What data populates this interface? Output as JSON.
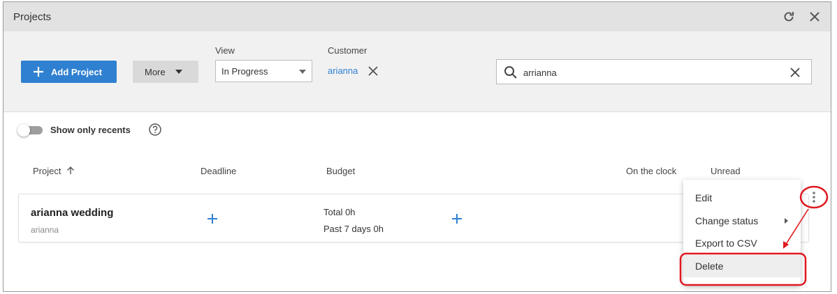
{
  "window": {
    "title": "Projects"
  },
  "toolbar": {
    "add_label": "Add Project",
    "more_label": "More",
    "view_label": "View",
    "view_value": "In Progress",
    "customer_label": "Customer",
    "customer_value": "arianna",
    "search_value": "arrianna"
  },
  "filters": {
    "recents_label": "Show only recents"
  },
  "table": {
    "columns": [
      "Project",
      "Deadline",
      "Budget",
      "On the clock",
      "Unread"
    ],
    "rows": [
      {
        "name": "arianna wedding",
        "customer": "arianna",
        "budget_total": "Total 0h",
        "budget_past": "Past 7 days 0h"
      }
    ]
  },
  "context_menu": {
    "items": [
      "Edit",
      "Change status",
      "Export to CSV",
      "Delete"
    ]
  },
  "colors": {
    "accent": "#2f80d1",
    "annotation": "#e0191f"
  }
}
